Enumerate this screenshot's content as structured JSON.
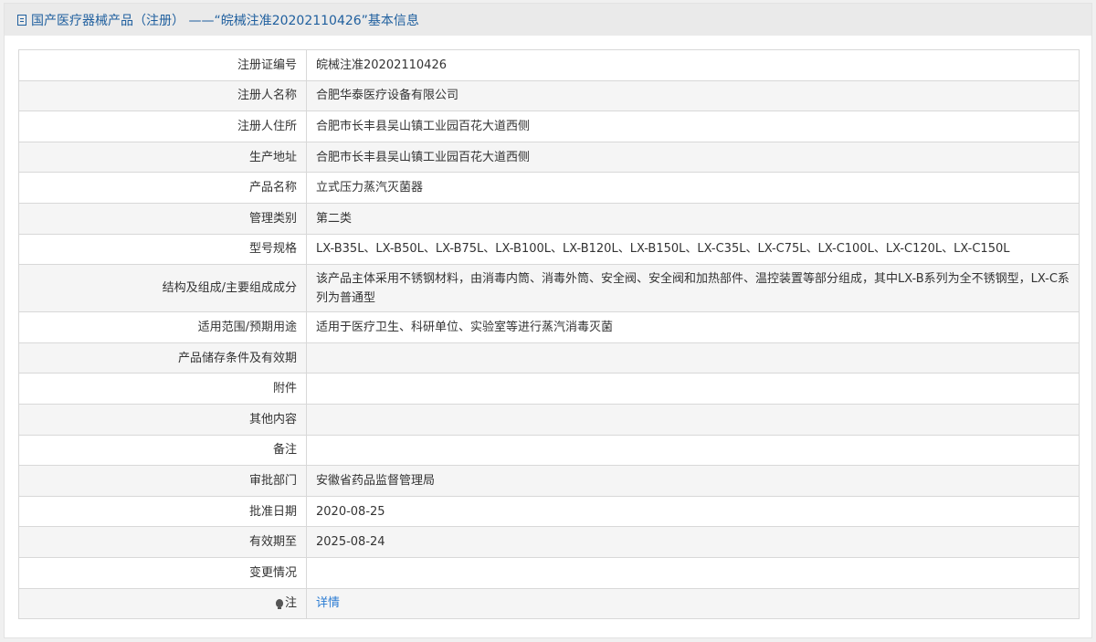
{
  "header": {
    "title": "国产医疗器械产品（注册） ——“皖械注准20202110426”基本信息"
  },
  "rows": [
    {
      "label": "注册证编号",
      "value": "皖械注准20202110426"
    },
    {
      "label": "注册人名称",
      "value": "合肥华泰医疗设备有限公司"
    },
    {
      "label": "注册人住所",
      "value": "合肥市长丰县吴山镇工业园百花大道西侧"
    },
    {
      "label": "生产地址",
      "value": "合肥市长丰县吴山镇工业园百花大道西侧"
    },
    {
      "label": "产品名称",
      "value": "立式压力蒸汽灭菌器"
    },
    {
      "label": "管理类别",
      "value": "第二类"
    },
    {
      "label": "型号规格",
      "value": "LX-B35L、LX-B50L、LX-B75L、LX-B100L、LX-B120L、LX-B150L、LX-C35L、LX-C75L、LX-C100L、LX-C120L、LX-C150L"
    },
    {
      "label": "结构及组成/主要组成成分",
      "value": "该产品主体采用不锈钢材料，由消毒内筒、消毒外筒、安全阀、安全阀和加热部件、温控装置等部分组成，其中LX-B系列为全不锈钢型，LX-C系列为普通型"
    },
    {
      "label": "适用范围/预期用途",
      "value": "适用于医疗卫生、科研单位、实验室等进行蒸汽消毒灭菌"
    },
    {
      "label": "产品储存条件及有效期",
      "value": ""
    },
    {
      "label": "附件",
      "value": ""
    },
    {
      "label": "其他内容",
      "value": ""
    },
    {
      "label": "备注",
      "value": ""
    },
    {
      "label": "审批部门",
      "value": "安徽省药品监督管理局"
    },
    {
      "label": "批准日期",
      "value": "2020-08-25"
    },
    {
      "label": "有效期至",
      "value": "2025-08-24"
    },
    {
      "label": "变更情况",
      "value": ""
    }
  ],
  "note_row": {
    "label": "注",
    "link_text": "详情",
    "icon": "lightbulb-icon"
  }
}
